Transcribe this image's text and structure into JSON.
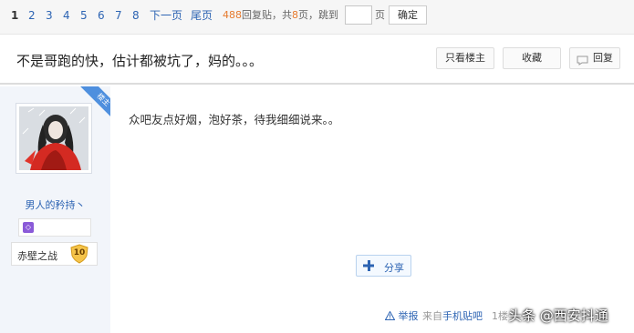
{
  "pager": {
    "current_page": "1",
    "pages": [
      "2",
      "3",
      "4",
      "5",
      "6",
      "7",
      "8"
    ],
    "next_label": "下一页",
    "last_label": "尾页",
    "reply_count": "488",
    "reply_text": "回复贴，共",
    "total_pages": "8",
    "pages_text": "页，跳到",
    "page_suffix": "页",
    "confirm_label": "确定"
  },
  "thread": {
    "title": "不是哥跑的快，估计都被坑了，妈的。。。",
    "only_op_label": "只看楼主",
    "favorite_label": "收藏",
    "reply_label": "回复"
  },
  "user": {
    "badge": "楼主",
    "name": "男人的矜持丶",
    "medal_icon": "medal-icon",
    "level_name": "赤壁之战",
    "level": "10"
  },
  "post": {
    "content": "众吧友点好烟，泡好茶，待我细细说来。。",
    "share_label": "分享",
    "report_label": "举报",
    "source_prefix": "来自",
    "source_link": "手机贴吧",
    "floor": "1楼"
  },
  "watermark": "头条 @西安抖通",
  "colors": {
    "link": "#2d64b3",
    "reply_count": "#e67a2e",
    "badge": "#4e8fde",
    "user_bg": "#f2f5fa"
  }
}
